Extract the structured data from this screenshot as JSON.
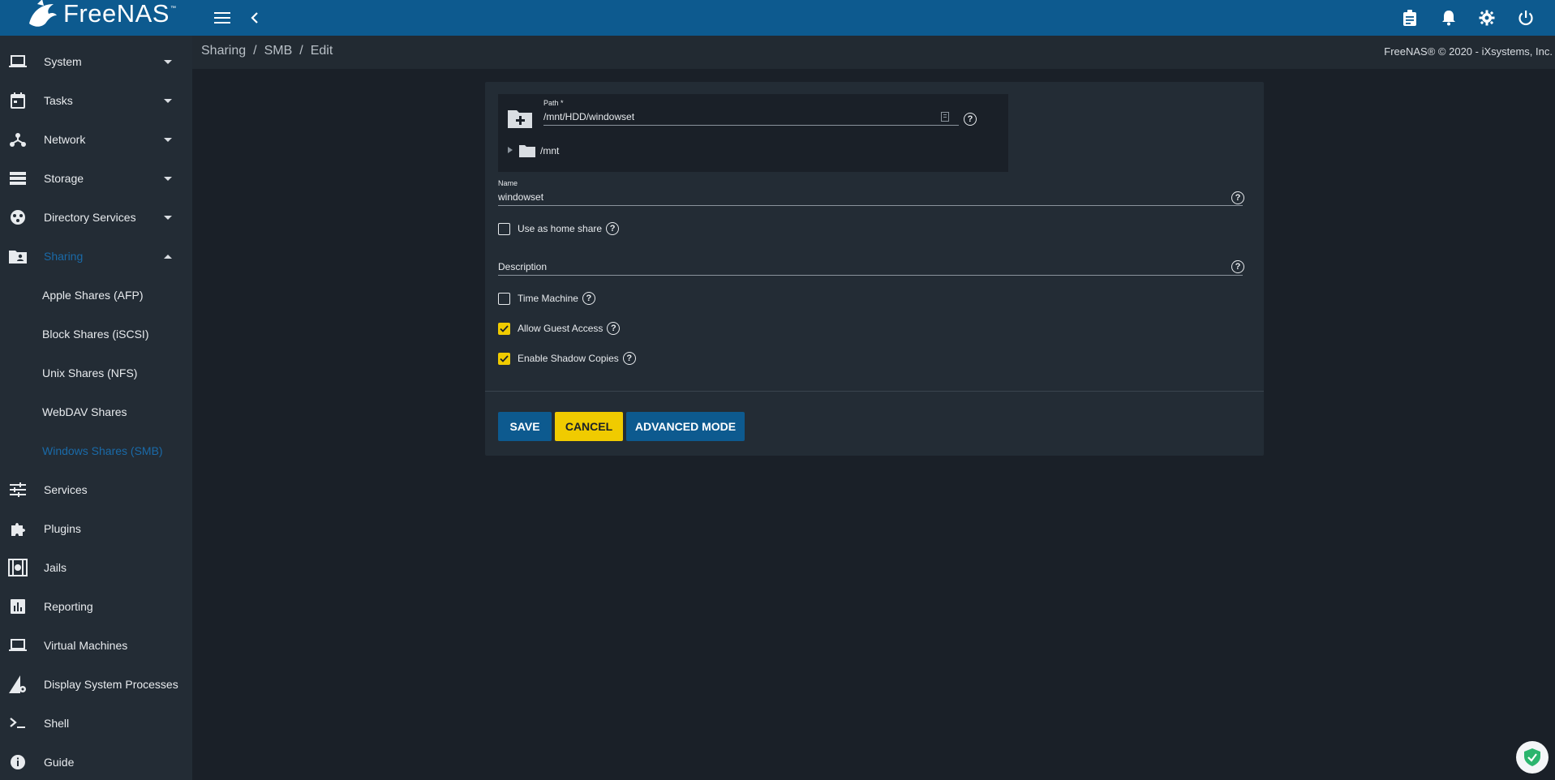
{
  "app": {
    "logo_text": "FreeNAS",
    "logo_tm": "™",
    "copyright": "FreeNAS® © 2020 - iXsystems, Inc."
  },
  "breadcrumb": [
    "Sharing",
    "SMB",
    "Edit"
  ],
  "breadcrumb_sep": "/",
  "sidebar": {
    "items": [
      {
        "label": "System",
        "icon": "laptop-icon",
        "expandable": true
      },
      {
        "label": "Tasks",
        "icon": "calendar-icon",
        "expandable": true
      },
      {
        "label": "Network",
        "icon": "network-icon",
        "expandable": true
      },
      {
        "label": "Storage",
        "icon": "storage-icon",
        "expandable": true
      },
      {
        "label": "Directory Services",
        "icon": "directory-icon",
        "expandable": true
      },
      {
        "label": "Sharing",
        "icon": "folder-shared-icon",
        "expandable": true,
        "expanded": true,
        "active": true
      },
      {
        "label": "Services",
        "icon": "tune-icon"
      },
      {
        "label": "Plugins",
        "icon": "puzzle-icon"
      },
      {
        "label": "Jails",
        "icon": "jail-icon"
      },
      {
        "label": "Reporting",
        "icon": "chart-icon"
      },
      {
        "label": "Virtual Machines",
        "icon": "laptop-icon"
      },
      {
        "label": "Display System Processes",
        "icon": "process-icon"
      },
      {
        "label": "Shell",
        "icon": "terminal-icon"
      },
      {
        "label": "Guide",
        "icon": "info-icon"
      }
    ],
    "sharing_children": [
      {
        "label": "Apple Shares (AFP)"
      },
      {
        "label": "Block Shares (iSCSI)"
      },
      {
        "label": "Unix Shares (NFS)"
      },
      {
        "label": "WebDAV Shares"
      },
      {
        "label": "Windows Shares (SMB)",
        "active": true
      }
    ]
  },
  "form": {
    "path_label": "Path *",
    "path_value": "/mnt/HDD/windowset",
    "tree_root": "/mnt",
    "name_label": "Name",
    "name_value": "windowset",
    "home_share_label": "Use as home share",
    "home_share_checked": false,
    "description_placeholder": "Description",
    "time_machine_label": "Time Machine",
    "time_machine_checked": false,
    "guest_access_label": "Allow Guest Access",
    "guest_access_checked": true,
    "shadow_copies_label": "Enable Shadow Copies",
    "shadow_copies_checked": true,
    "help_glyph": "?"
  },
  "buttons": {
    "save": "SAVE",
    "cancel": "CANCEL",
    "advanced": "ADVANCED MODE"
  },
  "colors": {
    "topbar": "#0d5a8f",
    "sidebar": "#232c35",
    "background": "#1a2028",
    "accent_yellow": "#f0cb00",
    "active_link": "#1a6aa8"
  }
}
